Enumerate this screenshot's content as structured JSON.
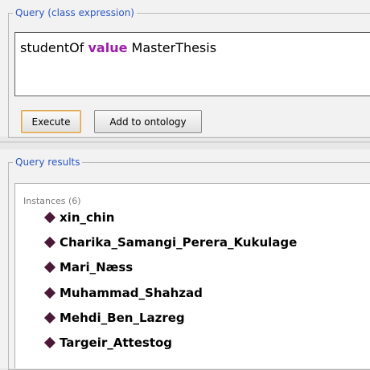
{
  "query_panel": {
    "legend": "Query (class expression)",
    "expression": {
      "prefix": "studentOf ",
      "keyword": "value",
      "suffix": " MasterThesis"
    },
    "execute_label": "Execute",
    "add_label": "Add to ontology"
  },
  "results_panel": {
    "legend": "Query results",
    "header": "Instances (6)",
    "instances": [
      "xin_chin",
      "Charika_Samangi_Perera_Kukulage",
      "Mari_Næss",
      "Muhammad_Shahzad",
      "Mehdi_Ben_Lazreg",
      "Targeir_Attestog"
    ]
  },
  "colors": {
    "legend": "#2b56c4",
    "keyword": "#9a1fa8",
    "instance_icon": "#4b1937"
  },
  "icons": {
    "instance": "diamond-icon"
  }
}
